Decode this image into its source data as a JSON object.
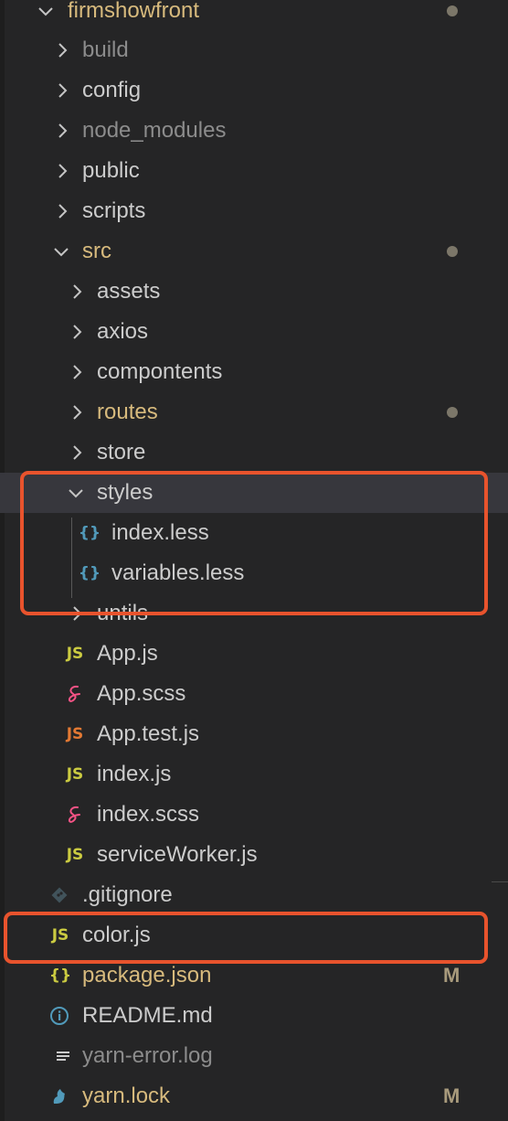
{
  "explorer": {
    "items": [
      {
        "label": "firmshowfront",
        "kind": "folder",
        "expanded": true,
        "color": "#d7ba7d",
        "modified_dot": true
      },
      {
        "label": "build",
        "kind": "folder",
        "expanded": false,
        "color": "#8c8c8c"
      },
      {
        "label": "config",
        "kind": "folder",
        "expanded": false,
        "color": "#cccccc"
      },
      {
        "label": "node_modules",
        "kind": "folder",
        "expanded": false,
        "color": "#8c8c8c"
      },
      {
        "label": "public",
        "kind": "folder",
        "expanded": false,
        "color": "#cccccc"
      },
      {
        "label": "scripts",
        "kind": "folder",
        "expanded": false,
        "color": "#cccccc"
      },
      {
        "label": "src",
        "kind": "folder",
        "expanded": true,
        "color": "#d7ba7d",
        "modified_dot": true
      },
      {
        "label": "assets",
        "kind": "folder",
        "expanded": false,
        "color": "#cccccc"
      },
      {
        "label": "axios",
        "kind": "folder",
        "expanded": false,
        "color": "#cccccc"
      },
      {
        "label": "compontents",
        "kind": "folder",
        "expanded": false,
        "color": "#cccccc"
      },
      {
        "label": "routes",
        "kind": "folder",
        "expanded": false,
        "color": "#d7ba7d",
        "modified_dot": true
      },
      {
        "label": "store",
        "kind": "folder",
        "expanded": false,
        "color": "#cccccc"
      },
      {
        "label": "styles",
        "kind": "folder",
        "expanded": true,
        "color": "#cccccc",
        "selected": true
      },
      {
        "label": "index.less",
        "kind": "file",
        "icon": "braces-icon",
        "icon_text": "{}",
        "icon_color": "#519aba",
        "color": "#cccccc"
      },
      {
        "label": "variables.less",
        "kind": "file",
        "icon": "braces-icon",
        "icon_text": "{}",
        "icon_color": "#519aba",
        "color": "#cccccc"
      },
      {
        "label": "untils",
        "kind": "folder",
        "expanded": false,
        "color": "#cccccc"
      },
      {
        "label": "App.js",
        "kind": "file",
        "icon": "js-icon",
        "icon_text": "JS",
        "icon_color": "#cbcb41",
        "color": "#cccccc"
      },
      {
        "label": "App.scss",
        "kind": "file",
        "icon": "sass-icon",
        "icon_color": "#f55385",
        "color": "#cccccc"
      },
      {
        "label": "App.test.js",
        "kind": "file",
        "icon": "js-test-icon",
        "icon_text": "JS",
        "icon_color": "#e37933",
        "color": "#cccccc"
      },
      {
        "label": "index.js",
        "kind": "file",
        "icon": "js-icon",
        "icon_text": "JS",
        "icon_color": "#cbcb41",
        "color": "#cccccc"
      },
      {
        "label": "index.scss",
        "kind": "file",
        "icon": "sass-icon",
        "icon_color": "#f55385",
        "color": "#cccccc"
      },
      {
        "label": "serviceWorker.js",
        "kind": "file",
        "icon": "js-icon",
        "icon_text": "JS",
        "icon_color": "#cbcb41",
        "color": "#cccccc"
      },
      {
        "label": ".gitignore",
        "kind": "file",
        "icon": "git-icon",
        "icon_color": "#41535b",
        "color": "#cccccc"
      },
      {
        "label": "color.js",
        "kind": "file",
        "icon": "js-icon",
        "icon_text": "JS",
        "icon_color": "#cbcb41",
        "color": "#cccccc"
      },
      {
        "label": "package.json",
        "kind": "file",
        "icon": "braces-icon",
        "icon_text": "{}",
        "icon_color": "#cbcb41",
        "color": "#d7ba7d",
        "badge": "M"
      },
      {
        "label": "README.md",
        "kind": "file",
        "icon": "info-icon",
        "icon_color": "#519aba",
        "color": "#cccccc"
      },
      {
        "label": "yarn-error.log",
        "kind": "file",
        "icon": "log-icon",
        "icon_color": "#cccccc",
        "color": "#8c8c8c"
      },
      {
        "label": "yarn.lock",
        "kind": "file",
        "icon": "yarn-icon",
        "icon_color": "#519aba",
        "color": "#d7ba7d",
        "badge": "M"
      }
    ]
  },
  "annotations": {
    "box_color": "#e8532d"
  }
}
